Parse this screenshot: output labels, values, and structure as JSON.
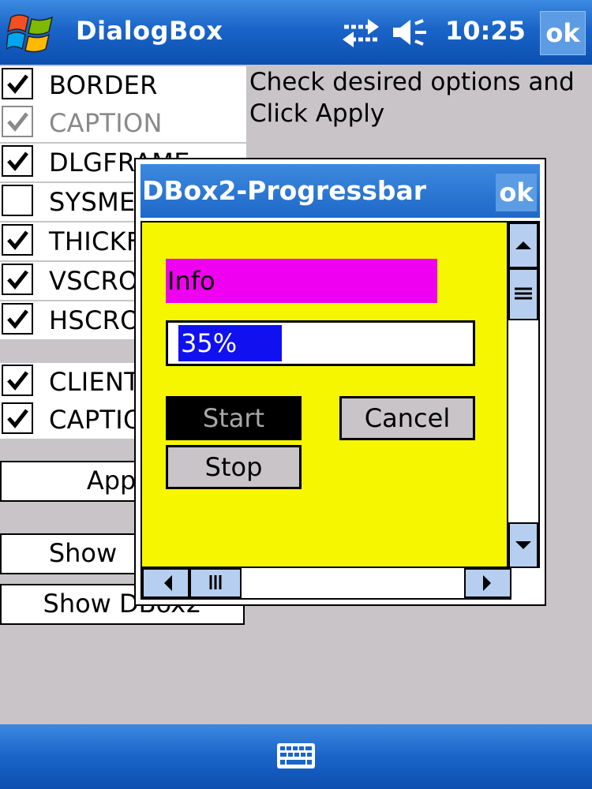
{
  "taskbar": {
    "title": "DialogBox",
    "time": "10:25",
    "ok_label": "ok"
  },
  "main": {
    "instructions": "Check desired options and Click Apply",
    "options": [
      {
        "label": "BORDER",
        "checked": true,
        "disabled": false
      },
      {
        "label": "CAPTION",
        "checked": true,
        "disabled": true
      },
      {
        "label": "DLGFRAME",
        "checked": true,
        "disabled": false
      },
      {
        "label": "SYSMENU",
        "checked": false,
        "disabled": false
      },
      {
        "label": "THICKFRAME",
        "checked": true,
        "disabled": false
      },
      {
        "label": "VSCROLL",
        "checked": true,
        "disabled": false
      },
      {
        "label": "HSCROLL",
        "checked": true,
        "disabled": false
      }
    ],
    "extra_options": [
      {
        "label": "CLIENTEDGE",
        "checked": true
      },
      {
        "label": "CAPTIONOKBTN",
        "checked": true
      }
    ],
    "buttons": {
      "apply": "Apply",
      "show": "Show",
      "show_dbox2": "Show DBox2"
    }
  },
  "dialog": {
    "title": "DBox2-Progressbar",
    "ok_label": "ok",
    "info_label": "Info",
    "progress": {
      "percent": 35,
      "text": "35%"
    },
    "start_label": "Start",
    "cancel_label": "Cancel",
    "stop_label": "Stop"
  },
  "colors": {
    "taskbar_blue": "#1a64c8",
    "client_yellow": "#f6f600",
    "info_magenta": "#f000f0",
    "progress_blue": "#1010f0"
  },
  "icons": {
    "start": "windows-flag-icon",
    "connectivity": "connectivity-arrows-icon",
    "volume": "speaker-icon",
    "keyboard": "keyboard-icon"
  }
}
